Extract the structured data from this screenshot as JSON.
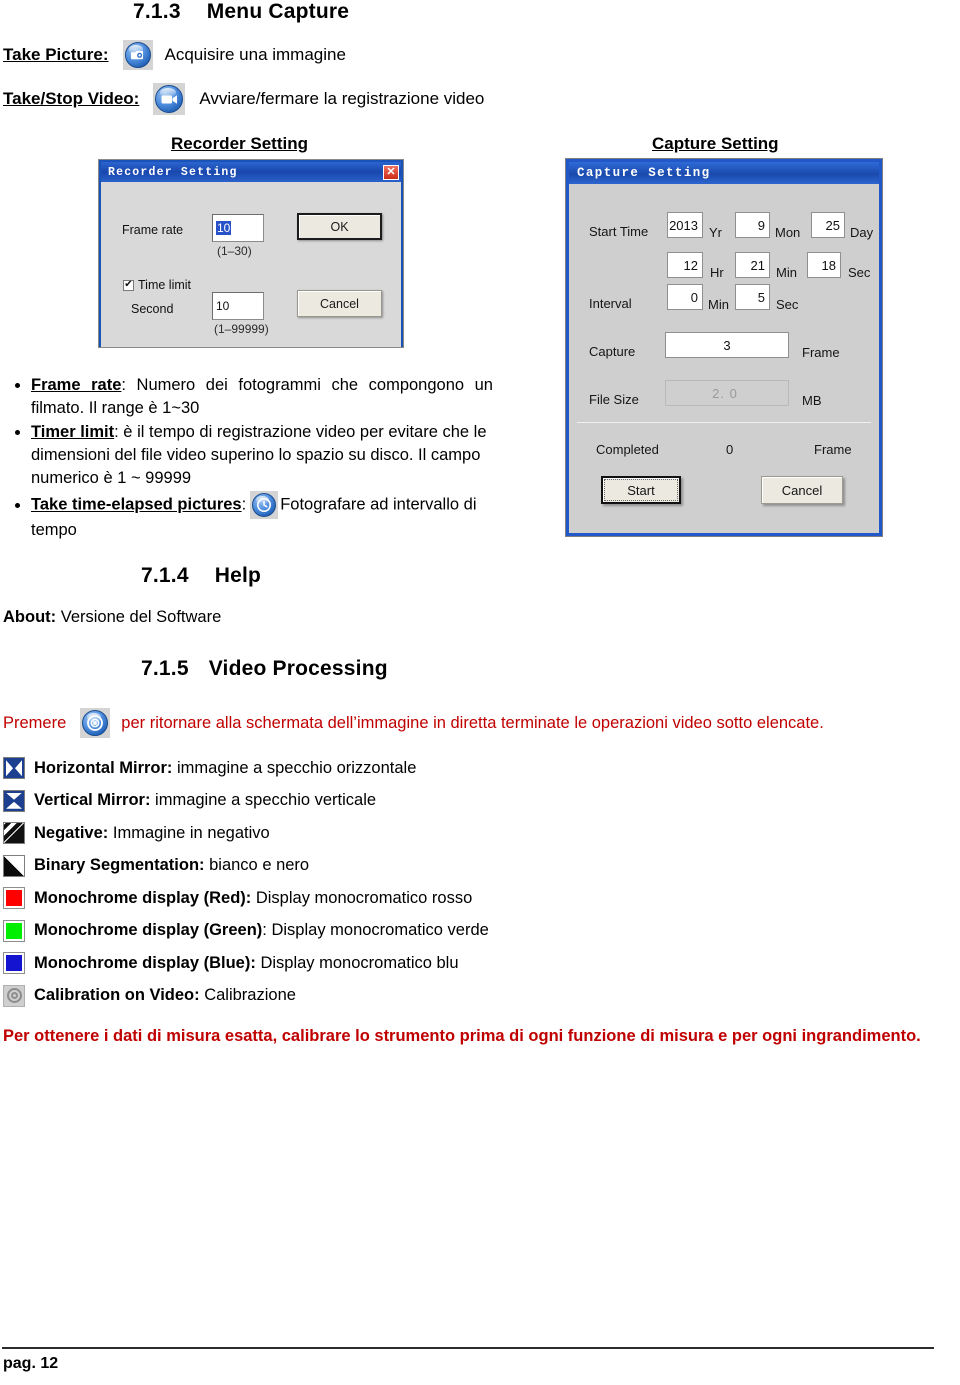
{
  "headings": {
    "capture_menu_num": "7.1.3",
    "capture_menu_title": "Menu Capture",
    "help_num": "7.1.4",
    "help_title": "Help",
    "video_proc_num": "7.1.5",
    "video_proc_title": "Video Processing"
  },
  "definitions": {
    "take_picture_term": "Take Picture:",
    "take_picture_desc": "Acquisire una immagine",
    "take_video_term": "Take/Stop Video:",
    "take_video_desc": "Avviare/fermare la registrazione video"
  },
  "captions": {
    "recorder": "Recorder Setting",
    "capture": "Capture Setting"
  },
  "recorder_dialog": {
    "title": "Recorder Setting",
    "close_label": "✕",
    "frame_rate_label": "Frame rate",
    "frame_rate_value": "10",
    "frame_rate_range": "(1–30)",
    "time_limit_label": "Time limit",
    "time_limit_checked": "✔",
    "second_label": "Second",
    "second_value": "10",
    "second_range": "(1–99999)",
    "ok_label": "OK",
    "cancel_label": "Cancel"
  },
  "capture_dialog": {
    "title": "Capture Setting",
    "start_time_label": "Start Time",
    "year_value": "2013",
    "year_unit": "Yr",
    "month_value": "9",
    "month_unit": "Mon",
    "day_value": "25",
    "day_unit": "Day",
    "hour_value": "12",
    "hour_unit": "Hr",
    "minute_value": "21",
    "minute_unit": "Min",
    "second_value": "18",
    "second_unit": "Sec",
    "interval_label": "Interval",
    "interval_min_value": "0",
    "interval_min_unit": "Min",
    "interval_sec_value": "5",
    "interval_sec_unit": "Sec",
    "capture_label": "Capture",
    "capture_value": "3",
    "capture_unit": "Frame",
    "file_size_label": "File Size",
    "file_size_value": "2. 0",
    "file_size_unit": "MB",
    "completed_label": "Completed",
    "completed_value": "0",
    "completed_unit": "Frame",
    "start_label": "Start",
    "cancel_label": "Cancel"
  },
  "bullets": [
    {
      "term": "Frame rate",
      "text": ": Numero dei fotogrammi che compongono un filmato. Il range è 1~30"
    },
    {
      "term": "Timer limit",
      "text": ": è il tempo di registrazione video per evitare che le dimensioni del file video superino lo spazio su disco. Il campo numerico è 1 ~ 99999"
    },
    {
      "term": "Take time-elapsed pictures",
      "text": ":",
      "after_icon": "Fotografare ad intervallo di tempo"
    }
  ],
  "about": {
    "term": "About:",
    "text": " Versione del Software"
  },
  "premere": {
    "before": "Premere",
    "after": "per ritornare alla schermata dell’immagine in diretta terminate le operazioni video sotto elencate."
  },
  "processing": [
    {
      "icon": "horizontal-mirror-icon",
      "term": "Horizontal Mirror:",
      "desc": " immagine a specchio orizzontale"
    },
    {
      "icon": "vertical-mirror-icon",
      "term": "Vertical Mirror:",
      "desc": " immagine a specchio verticale"
    },
    {
      "icon": "negative-icon",
      "term": "Negative:",
      "desc": " Immagine in negativo"
    },
    {
      "icon": "binary-segmentation-icon",
      "term": "Binary Segmentation:",
      "desc": " bianco e nero"
    },
    {
      "icon": "monochrome-red-icon",
      "term": "Monochrome display (Red):",
      "desc": " Display monocromatico rosso",
      "color": "#ff0000"
    },
    {
      "icon": "monochrome-green-icon",
      "term": "Monochrome display (Green)",
      "desc": ": Display monocromatico verde",
      "color": "#00ee00"
    },
    {
      "icon": "monochrome-blue-icon",
      "term": "Monochrome display (Blue):",
      "desc": " Display monocromatico blu",
      "color": "#1414d0"
    },
    {
      "icon": "calibration-icon",
      "term": "Calibration on Video:",
      "desc": " Calibrazione"
    }
  ],
  "warning": "Per ottenere i dati di misura esatta, calibrare lo strumento prima di ogni funzione di misura e per ogni ingrandimento.",
  "footer": {
    "page": "pag. 12"
  },
  "colors": {
    "accent_red": "#c00000",
    "title_blue": "#1a53b8",
    "dialog_gray": "#d8d8d8"
  }
}
